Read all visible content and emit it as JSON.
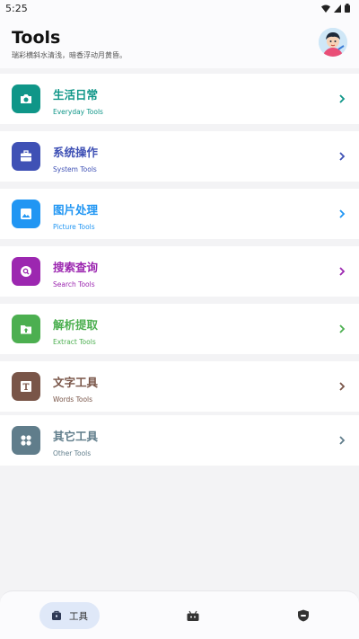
{
  "status_bar": {
    "time": "5:25"
  },
  "header": {
    "title": "Tools",
    "subtitle": "瑞彩横斜水清浅，暗香浮动月黄昏。"
  },
  "items": [
    {
      "title": "生活日常",
      "subtitle": "Everyday Tools",
      "color": "#0f9688",
      "icon": "camera-icon"
    },
    {
      "title": "系统操作",
      "subtitle": "System Tools",
      "color": "#3f51b5",
      "icon": "briefcase-icon"
    },
    {
      "title": "图片处理",
      "subtitle": "Picture Tools",
      "color": "#2196f3",
      "icon": "image-icon"
    },
    {
      "title": "搜索查询",
      "subtitle": "Search Tools",
      "color": "#9c27b0",
      "icon": "search-icon"
    },
    {
      "title": "解析提取",
      "subtitle": "Extract Tools",
      "color": "#4caf50",
      "icon": "folder-upload-icon"
    },
    {
      "title": "文字工具",
      "subtitle": "Words Tools",
      "color": "#795548",
      "icon": "text-icon"
    },
    {
      "title": "其它工具",
      "subtitle": "Other Tools",
      "color": "#607d8b",
      "icon": "apps-icon"
    }
  ],
  "bottom_nav": {
    "tools_label": "工具",
    "accent": "#dfe8f8"
  }
}
